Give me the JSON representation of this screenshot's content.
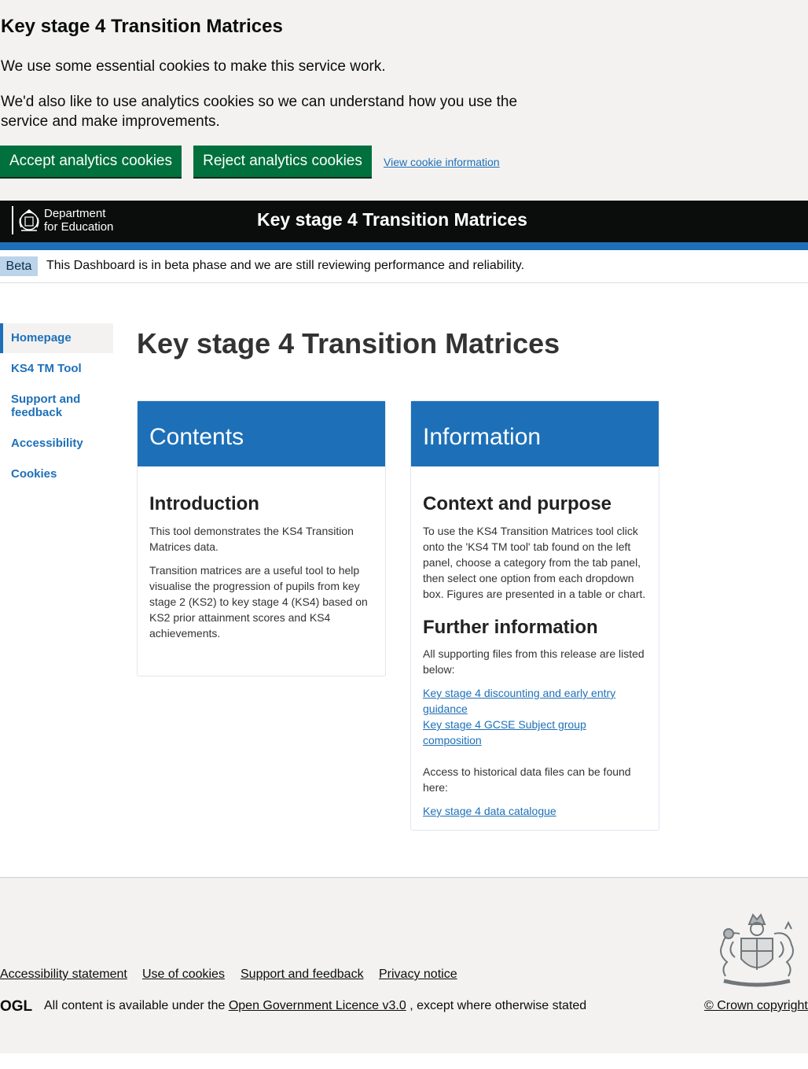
{
  "cookie_banner": {
    "title": "Key stage 4 Transition Matrices",
    "text1": "We use some essential cookies to make this service work.",
    "text2": "We'd also like to use analytics cookies so we can understand how you use the service and make improvements.",
    "accept_label": "Accept analytics cookies",
    "reject_label": "Reject analytics cookies",
    "info_link": "View cookie information"
  },
  "header": {
    "dept_line1": "Department",
    "dept_line2": "for Education",
    "title": "Key stage 4 Transition Matrices"
  },
  "beta": {
    "tag": "Beta",
    "text": "This Dashboard is in beta phase and we are still reviewing performance and reliability."
  },
  "sidebar": {
    "items": [
      {
        "label": "Homepage"
      },
      {
        "label": "KS4 TM Tool"
      },
      {
        "label": "Support and feedback"
      },
      {
        "label": "Accessibility"
      },
      {
        "label": "Cookies"
      }
    ]
  },
  "main": {
    "title": "Key stage 4 Transition Matrices",
    "contents_card": {
      "header": "Contents",
      "section_title": "Introduction",
      "p1": "This tool demonstrates the KS4 Transition Matrices data.",
      "p2": "Transition matrices are a useful tool to help visualise the progression of pupils from key stage 2 (KS2) to key stage 4 (KS4) based on KS2 prior attainment scores and KS4 achievements."
    },
    "information_card": {
      "header": "Information",
      "context_title": "Context and purpose",
      "context_text": "To use the KS4 Transition Matrices tool click onto the 'KS4 TM tool' tab found on the left panel, choose a category from the tab panel, then select one option from each dropdown box. Figures are presented in a table or chart.",
      "further_title": "Further information",
      "further_text": "All supporting files from this release are listed below:",
      "link1": "Key stage 4 discounting and early entry guidance",
      "link2": "Key stage 4 GCSE Subject group composition",
      "historical_text": "Access to historical data files can be found here:",
      "link3": "Key stage 4 data catalogue"
    }
  },
  "footer": {
    "links": [
      "Accessibility statement",
      "Use of cookies",
      "Support and feedback",
      "Privacy notice"
    ],
    "ogl": "OGL",
    "licence_prefix": "All content is available under the",
    "licence_link": "Open Government Licence v3.0",
    "licence_suffix": ", except where otherwise stated",
    "copyright": "© Crown copyright"
  },
  "colors": {
    "accent_blue": "#1d70b8",
    "button_green": "#00703c",
    "header_black": "#0b0c0c",
    "banner_grey": "#f3f2f1"
  }
}
